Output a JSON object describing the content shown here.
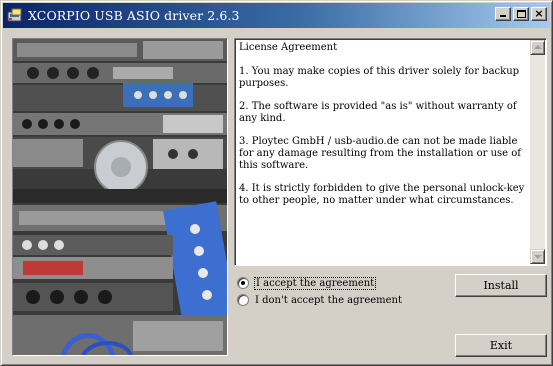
{
  "window": {
    "title": "XCORPIO USB ASIO driver 2.6.3",
    "titlebar_colors": [
      "#0a246a",
      "#a6caf0"
    ],
    "face_color": "#d4d0c8"
  },
  "titlebar_buttons": {
    "minimize_icon": "minimize-icon",
    "maximize_icon": "maximize-icon",
    "close_icon": "close-icon",
    "close_glyph": "×"
  },
  "license": {
    "heading": "License Agreement",
    "paragraphs": [
      "1. You may make copies of this driver solely for backup purposes.",
      "2. The software is provided \"as is\" without warranty of any kind.",
      "3. Ploytec GmbH / usb-audio.de can not be made liable for any damage resulting from the installation or use of this software.",
      "4. It is strictly forbidden to give the personal unlock-key to other people, no matter under what circumstances."
    ]
  },
  "options": {
    "accept_label": "I accept the agreement",
    "decline_label": "I don't accept the agreement",
    "selected": "accept"
  },
  "buttons": {
    "install_label": "Install",
    "exit_label": "Exit"
  }
}
